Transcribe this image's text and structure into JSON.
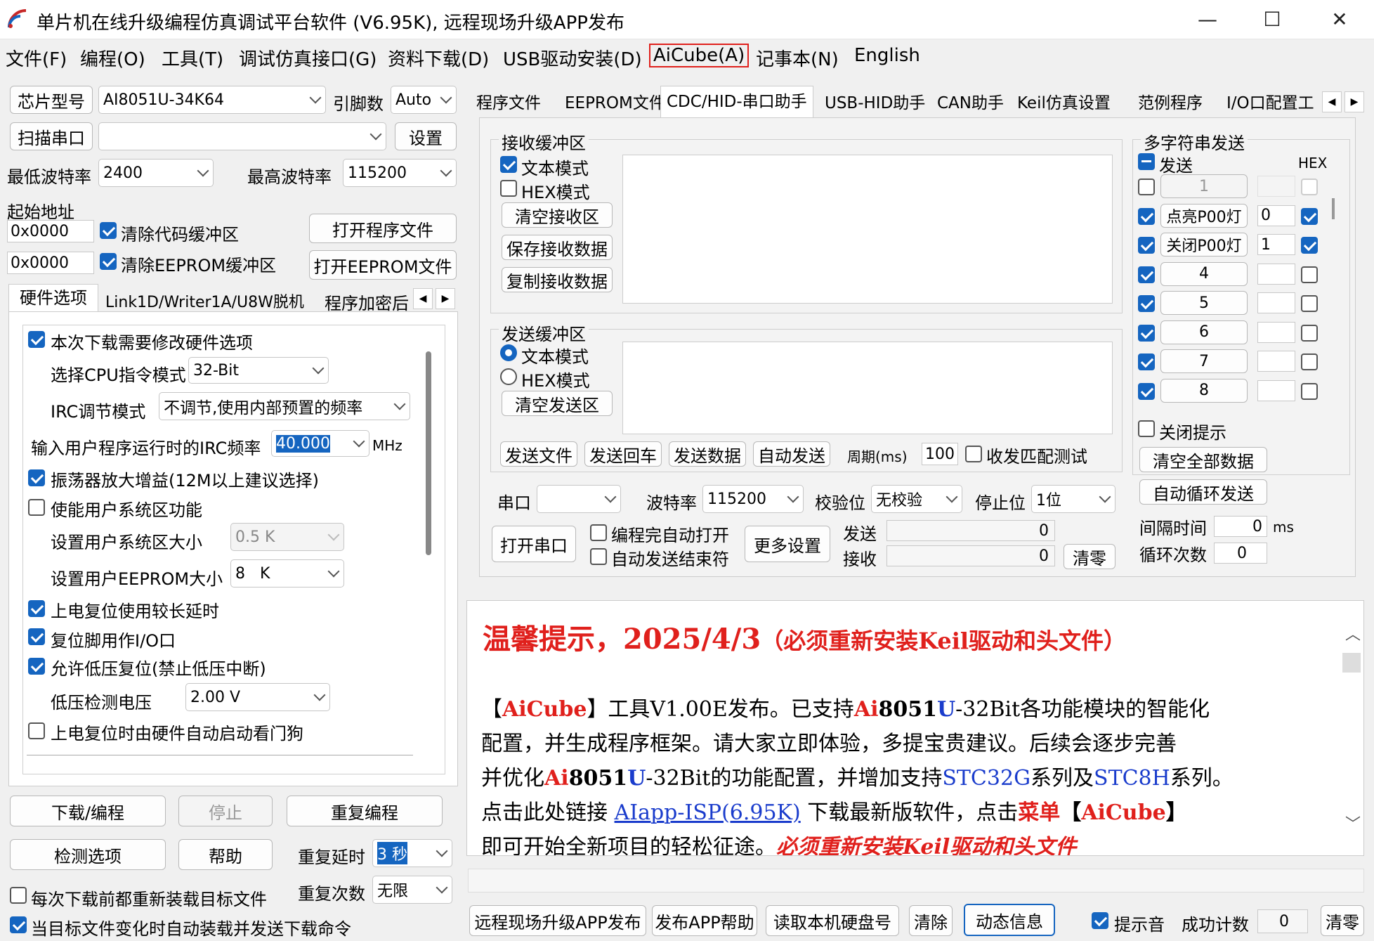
{
  "window": {
    "title": "单片机在线升级编程仿真调试平台软件 (V6.95K), 远程现场升级APP发布",
    "minimize": "—",
    "maximize": "☐",
    "close": "✕"
  },
  "menu": [
    "文件(F)",
    "编程(O)",
    "工具(T)",
    "调试仿真接口(G)",
    "资料下载(D)",
    "USB驱动安装(D)",
    "AiCube(A)",
    "记事本(N)",
    "English"
  ],
  "left": {
    "chip_label": "芯片型号",
    "chip_value": "AI8051U-34K64",
    "pins_label": "引脚数",
    "pins_value": "Auto",
    "scan_label": "扫描串口",
    "port_value": "",
    "set_label": "设置",
    "min_baud_label": "最低波特率",
    "min_baud": "2400",
    "max_baud_label": "最高波特率",
    "max_baud": "115200",
    "start_addr_label": "起始地址",
    "addr1": "0x0000",
    "clear_code": "清除代码缓冲区",
    "open_prog": "打开程序文件",
    "addr2": "0x0000",
    "clear_eeprom": "清除EEPROM缓冲区",
    "open_eeprom": "打开EEPROM文件",
    "tabs": [
      "硬件选项",
      "Link1D/Writer1A/U8W脱机",
      "程序加密后"
    ],
    "opts": {
      "modify": "本次下载需要修改硬件选项",
      "cpu_mode_label": "选择CPU指令模式",
      "cpu_mode": "32-Bit",
      "irc_label": "IRC调节模式",
      "irc_mode": "不调节,使用内部预置的频率",
      "freq_label": "输入用户程序运行时的IRC频率",
      "freq": "40.000",
      "freq_unit": "MHz",
      "osc": "振荡器放大增益(12M以上建议选择)",
      "sysarea": "使能用户系统区功能",
      "sys_size_label": "设置用户系统区大小",
      "sys_size": "0.5 K",
      "ee_size_label": "设置用户EEPROM大小",
      "ee_size": "8   K",
      "long_delay": "上电复位使用较长延时",
      "reset_io": "复位脚用作I/O口",
      "lvr": "允许低压复位(禁止低压中断)",
      "lv_label": "低压检测电压",
      "lv": "2.00 V",
      "wdt": "上电复位时由硬件自动启动看门狗"
    },
    "download": "下载/编程",
    "stop": "停止",
    "repeat": "重复编程",
    "detect": "检测选项",
    "help": "帮助",
    "repeat_delay_label": "重复延时",
    "repeat_delay": "3 秒",
    "repeat_count_label": "重复次数",
    "repeat_count": "无限",
    "reload": "每次下载前都重新装载目标文件",
    "auto_load": "当目标文件变化时自动装载并发送下载命令"
  },
  "right": {
    "tabs": [
      "程序文件",
      "EEPROM文件",
      "CDC/HID-串口助手",
      "USB-HID助手",
      "CAN助手",
      "Keil仿真设置",
      "范例程序",
      "I/O口配置工"
    ],
    "recv": {
      "title": "接收缓冲区",
      "text_mode": "文本模式",
      "hex_mode": "HEX模式",
      "clear": "清空接收区",
      "save": "保存接收数据",
      "copy": "复制接收数据"
    },
    "send": {
      "title": "发送缓冲区",
      "text_mode": "文本模式",
      "hex_mode": "HEX模式",
      "clear": "清空发送区",
      "send_file": "发送文件",
      "send_enter": "发送回车",
      "send_data": "发送数据",
      "auto_send": "自动发送",
      "period_label": "周期(ms)",
      "period": "100",
      "match": "收发匹配测试"
    },
    "multi": {
      "title": "多字符串发送",
      "send": "发送",
      "hex": "HEX",
      "rows": [
        {
          "name": "1",
          "val": "",
          "on": false,
          "hex": false
        },
        {
          "name": "点亮P00灯",
          "val": "0",
          "on": true,
          "hex": true
        },
        {
          "name": "关闭P00灯",
          "val": "1",
          "on": true,
          "hex": true
        },
        {
          "name": "4",
          "val": "",
          "on": true,
          "hex": false
        },
        {
          "name": "5",
          "val": "",
          "on": true,
          "hex": false
        },
        {
          "name": "6",
          "val": "",
          "on": true,
          "hex": false
        },
        {
          "name": "7",
          "val": "",
          "on": true,
          "hex": false
        },
        {
          "name": "8",
          "val": "",
          "on": true,
          "hex": false
        }
      ],
      "close_hint": "关闭提示",
      "clear_all": "清空全部数据",
      "auto_loop": "自动循环发送",
      "interval_label": "间隔时间",
      "interval": "0",
      "interval_unit": "ms",
      "loop_label": "循环次数",
      "loop": "0"
    },
    "port": {
      "port_label": "串口",
      "port_value": "",
      "baud_label": "波特率",
      "baud": "115200",
      "parity_label": "校验位",
      "parity": "无校验",
      "stop_label": "停止位",
      "stop": "1位",
      "open": "打开串口",
      "auto_open": "编程完自动打开",
      "auto_end": "自动发送结束符",
      "more": "更多设置",
      "sent_label": "发送",
      "sent": "0",
      "recv_label": "接收",
      "recv": "0",
      "clear": "清零"
    },
    "notice": {
      "headline": "温馨提示，2025/4/3",
      "headline_note": "（必须重新安装Keil驱动和头文件）",
      "l1_a": "【",
      "l1_b": "AiCube",
      "l1_c": "】工具V1.00E发布。已支持",
      "l1_d": "Ai",
      "l1_e": "8051",
      "l1_f": "U",
      "l1_g": "-32Bit各功能模块的智能化",
      "l2": "配置，并生成程序框架。请大家立即体验，多提宝贵建议。后续会逐步完善",
      "l3_a": "并优化",
      "l3_b": "Ai",
      "l3_c": "8051",
      "l3_d": "U",
      "l3_e": "-32Bit的功能配置，并增加支持",
      "l3_f": "STC32G",
      "l3_g": "系列及",
      "l3_h": "STC8H",
      "l3_i": "系列。",
      "l4_a": "点击此处链接 ",
      "l4_link": "AIapp-ISP(6.95K)",
      "l4_b": " 下载最新版软件，点击",
      "l4_c": "菜单",
      "l4_d": "【",
      "l4_e": "AiCube",
      "l4_f": "】",
      "l5_a": "即可开始全新项目的轻松征途。",
      "l5_b": "必须重新安装Keil驱动和头文件"
    },
    "bottom": {
      "remote": "远程现场升级APP发布",
      "app_help": "发布APP帮助",
      "disk": "读取本机硬盘号",
      "clear": "清除",
      "dynamic": "动态信息",
      "sound": "提示音",
      "success_label": "成功计数",
      "success": "0",
      "reset": "清零"
    }
  },
  "colors": {
    "accent": "#1565c0",
    "red": "#e0201c",
    "link": "#1a3ccc"
  }
}
